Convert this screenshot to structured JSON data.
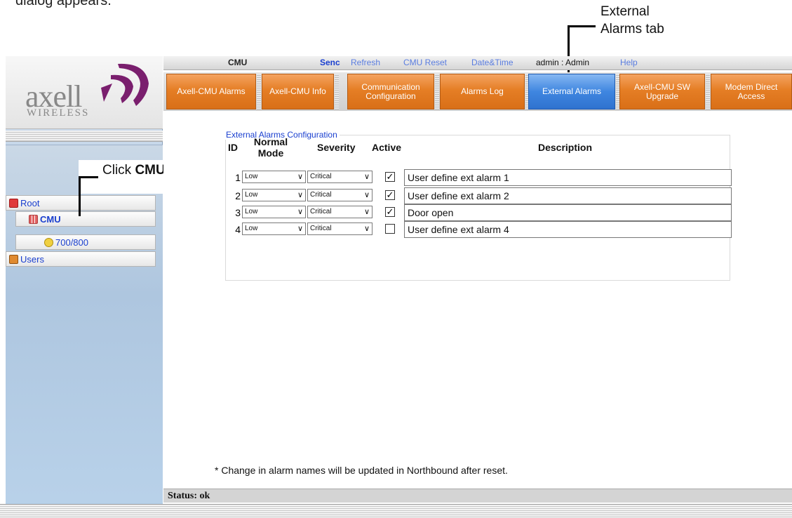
{
  "caption_partial": "dialog appears.",
  "callouts": {
    "external_alarms": "External Alarms tab",
    "external_alarms_line1": "External",
    "external_alarms_line2": "Alarms tab",
    "click_prefix": "Click ",
    "click_target": "CMU"
  },
  "logo": {
    "name": "axell",
    "sub": "WIRELESS"
  },
  "topbar": {
    "title": "CMU",
    "send": "Senc",
    "refresh": "Refresh",
    "cmu_reset": "CMU Reset",
    "date_time": "Date&Time",
    "user": "admin : Admin",
    "help": "Help"
  },
  "tabs": [
    {
      "label": "Axell-CMU Alarms",
      "active": false
    },
    {
      "label": "Axell-CMU Info",
      "active": false
    },
    {
      "label": "Communication Configuration",
      "active": false
    },
    {
      "label": "Alarms Log",
      "active": false
    },
    {
      "label": "External Alarms",
      "active": true
    },
    {
      "label": "Axell-CMU SW Upgrade",
      "active": false
    },
    {
      "label": "Modem Direct Access",
      "active": false
    }
  ],
  "tree": {
    "root": "Root",
    "cmu": "CMU",
    "child": "700/800",
    "users": "Users"
  },
  "section": {
    "legend": "External Alarms Configuration",
    "headers": {
      "id": "ID",
      "normal_mode": "Normal Mode",
      "severity": "Severity",
      "active": "Active",
      "description": "Description"
    },
    "rows": [
      {
        "id": "1",
        "normal_mode": "Low",
        "severity": "Critical",
        "active": true,
        "description": "User define ext alarm 1"
      },
      {
        "id": "2",
        "normal_mode": "Low",
        "severity": "Critical",
        "active": true,
        "description": "User define ext alarm 2"
      },
      {
        "id": "3",
        "normal_mode": "Low",
        "severity": "Critical",
        "active": true,
        "description": "Door open"
      },
      {
        "id": "4",
        "normal_mode": "Low",
        "severity": "Critical",
        "active": false,
        "description": "User define ext alarm 4"
      }
    ],
    "note": "* Change in alarm names will be updated in Northbound after reset."
  },
  "status": "Status: ok",
  "colors": {
    "tab_orange": "#e57e25",
    "tab_active_blue": "#3f86e0",
    "link_blue": "#1a3fcf",
    "logo_purple": "#7a1f6e"
  },
  "icons": {
    "root": "root-node-icon",
    "cmu": "cmu-grid-icon",
    "child": "alarm-status-icon",
    "users": "users-icon"
  }
}
